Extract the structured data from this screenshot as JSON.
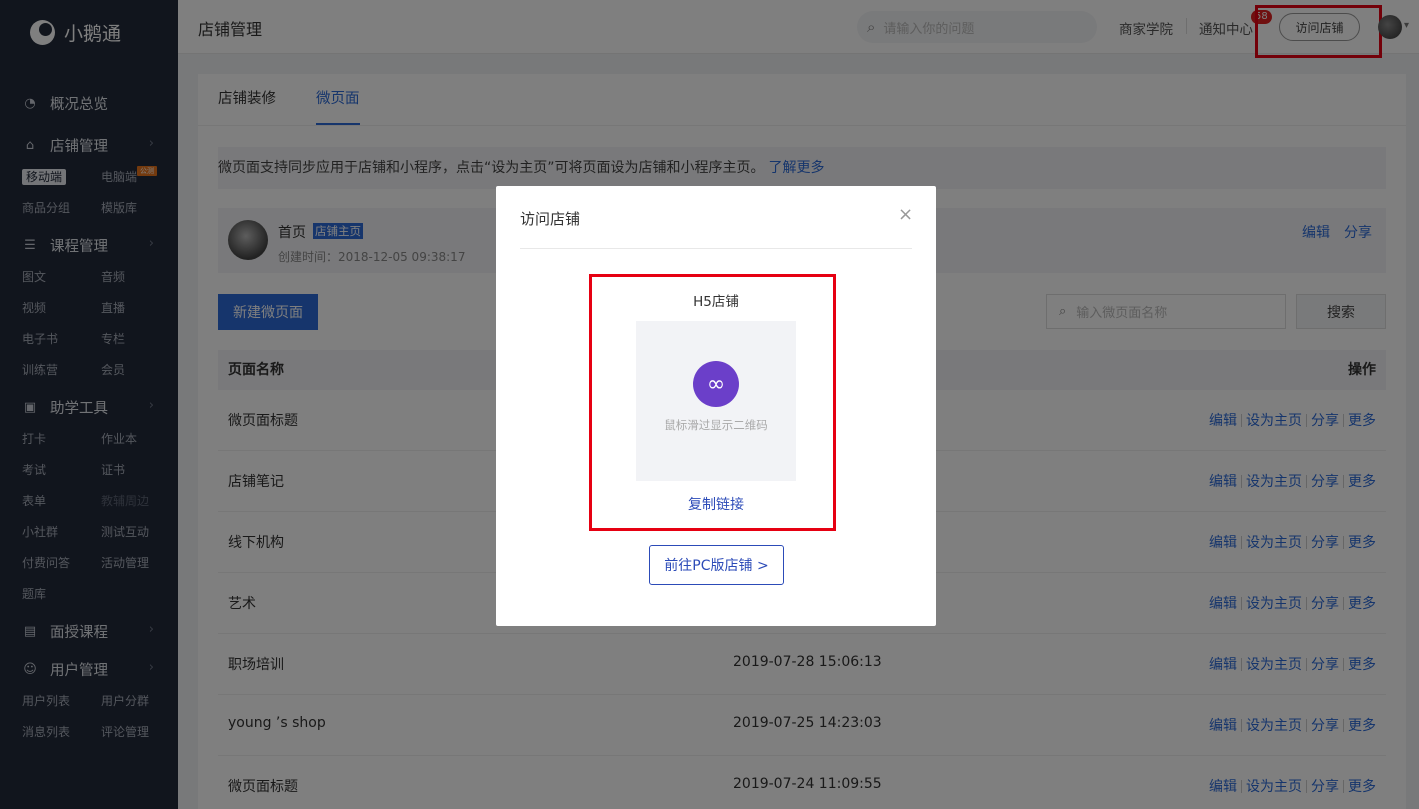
{
  "app": {
    "logo_text": "小鹅通"
  },
  "sidebar": {
    "groups": [
      {
        "label": "概况总览",
        "icon": "pie-chart-icon",
        "has_chevron": false,
        "items": []
      },
      {
        "label": "店铺管理",
        "icon": "store-icon",
        "has_chevron": true,
        "items": [
          {
            "label": "移动端",
            "active": true
          },
          {
            "label": "电脑端",
            "tag": "公测"
          },
          {
            "label": "商品分组"
          },
          {
            "label": "模版库"
          }
        ]
      },
      {
        "label": "课程管理",
        "icon": "document-icon",
        "has_chevron": true,
        "items": [
          {
            "label": "图文"
          },
          {
            "label": "音频"
          },
          {
            "label": "视频"
          },
          {
            "label": "直播"
          },
          {
            "label": "电子书"
          },
          {
            "label": "专栏"
          },
          {
            "label": "训练营"
          },
          {
            "label": "会员"
          }
        ]
      },
      {
        "label": "助学工具",
        "icon": "toolbox-icon",
        "has_chevron": true,
        "items": [
          {
            "label": "打卡"
          },
          {
            "label": "作业本"
          },
          {
            "label": "考试"
          },
          {
            "label": "证书"
          },
          {
            "label": "表单"
          },
          {
            "label": "教辅周边",
            "disabled": true
          },
          {
            "label": "小社群"
          },
          {
            "label": "测试互动"
          },
          {
            "label": "付费问答"
          },
          {
            "label": "活动管理"
          },
          {
            "label": "题库"
          }
        ]
      },
      {
        "label": "面授课程",
        "icon": "classroom-icon",
        "has_chevron": true,
        "items": []
      },
      {
        "label": "用户管理",
        "icon": "user-icon",
        "has_chevron": true,
        "items": [
          {
            "label": "用户列表"
          },
          {
            "label": "用户分群"
          },
          {
            "label": "消息列表"
          },
          {
            "label": "评论管理"
          }
        ]
      }
    ]
  },
  "header": {
    "title": "店铺管理",
    "search_placeholder": "请输入你的问题",
    "academy": "商家学院",
    "notifications": "通知中心",
    "notification_count": "58",
    "visit_store": "访问店铺"
  },
  "tabs": [
    {
      "label": "店铺装修",
      "active": false
    },
    {
      "label": "微页面",
      "active": true
    }
  ],
  "notice": {
    "text": "微页面支持同步应用于店铺和小程序，点击“设为主页”可将页面设为店铺和小程序主页。",
    "link": "了解更多"
  },
  "home_page": {
    "name": "首页",
    "tag": "店铺主页",
    "created": "创建时间：2018-12-05 09:38:17",
    "actions": [
      "编辑",
      "分享"
    ]
  },
  "toolbar": {
    "new_button": "新建微页面",
    "search_placeholder": "输入微页面名称",
    "search_button": "搜索"
  },
  "table": {
    "columns": [
      "页面名称",
      "操作"
    ],
    "row_actions": [
      "编辑",
      "设为主页",
      "分享",
      "更多"
    ],
    "rows": [
      {
        "name": "微页面标题",
        "time": ""
      },
      {
        "name": "店铺笔记",
        "time": ""
      },
      {
        "name": "线下机构",
        "time": ""
      },
      {
        "name": "艺术",
        "time": ""
      },
      {
        "name": "职场培训",
        "time": "2019-07-28 15:06:13"
      },
      {
        "name": "young ’s shop",
        "time": "2019-07-25 14:23:03"
      },
      {
        "name": "微页面标题",
        "time": "2019-07-24 11:09:55"
      }
    ]
  },
  "modal": {
    "title": "访问店铺",
    "close": "×",
    "qr_title": "H5店铺",
    "qr_hint": "鼠标滑过显示二维码",
    "copy_link": "复制链接",
    "pc_button": "前往PC版店铺 >"
  },
  "colors": {
    "sidebar_bg": "#222a3a",
    "primary": "#2c6bd8",
    "highlight_border": "#e60012",
    "mini_program_icon": "#6b3fc9"
  }
}
